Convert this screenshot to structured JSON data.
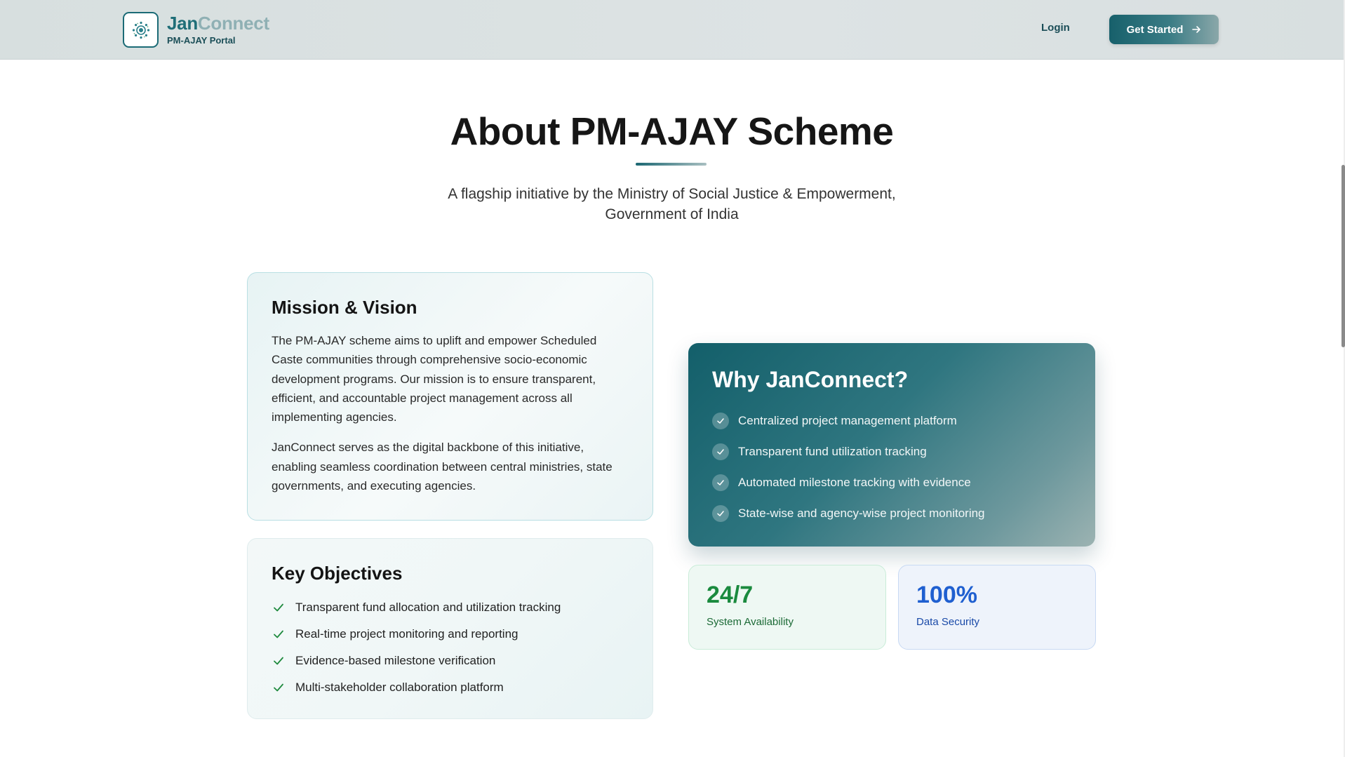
{
  "header": {
    "brand_part1": "Jan",
    "brand_part2": "Connect",
    "brand_subtitle": "PM-AJAY Portal",
    "login_label": "Login",
    "cta_label": "Get Started",
    "logo_icon": "gear-logo-icon",
    "cta_icon": "arrow-right-icon"
  },
  "section": {
    "title": "About PM-AJAY Scheme",
    "subtitle_line1": "A flagship initiative by the Ministry of Social Justice & Empowerment,",
    "subtitle_line2": "Government of India"
  },
  "mission": {
    "heading": "Mission & Vision",
    "para1": "The PM-AJAY scheme aims to uplift and empower Scheduled Caste communities through comprehensive socio-economic development programs. Our mission is to ensure transparent, efficient, and accountable project management across all implementing agencies.",
    "para2": "JanConnect serves as the digital backbone of this initiative, enabling seamless coordination between central ministries, state governments, and executing agencies."
  },
  "objectives": {
    "heading": "Key Objectives",
    "items": [
      "Transparent fund allocation and utilization tracking",
      "Real-time project monitoring and reporting",
      "Evidence-based milestone verification",
      "Multi-stakeholder collaboration platform"
    ]
  },
  "why": {
    "heading": "Why JanConnect?",
    "items": [
      "Centralized project management platform",
      "Transparent fund utilization tracking",
      "Automated milestone tracking with evidence",
      "State-wise and agency-wise project monitoring"
    ]
  },
  "stats": {
    "availability": {
      "value": "24/7",
      "label": "System Availability"
    },
    "security": {
      "value": "100%",
      "label": "Data Security"
    }
  },
  "colors": {
    "brand_teal": "#1f6e78",
    "stat_green": "#1a8a3e",
    "stat_blue": "#1f5fd0"
  }
}
